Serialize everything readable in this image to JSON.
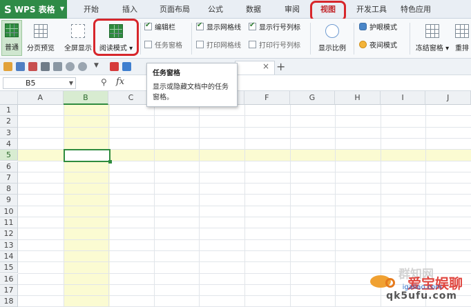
{
  "app": {
    "logo_mark": "S",
    "name": "WPS 表格"
  },
  "tabs": [
    "开始",
    "插入",
    "页面布局",
    "公式",
    "数据",
    "审阅",
    "视图",
    "开发工具",
    "特色应用"
  ],
  "active_tab": "视图",
  "ribbon": {
    "normal": "普通",
    "page_preview": "分页预览",
    "fullscreen": "全屏显示",
    "reading_mode": "阅读模式",
    "edit_bar": "编辑栏",
    "task_pane": "任务窗格",
    "show_gridlines": "显示网格线",
    "print_gridlines": "打印网格线",
    "show_row_col_headers": "显示行号列标",
    "print_row_col_headers": "打印行号列标",
    "zoom": "显示比例",
    "eye_protection": "护眼模式",
    "night_mode": "夜间模式",
    "freeze_panes": "冻结窗格",
    "rearrange": "重排"
  },
  "formula_bar": {
    "cell_ref": "B5",
    "fx": "fx"
  },
  "tooltip": {
    "title": "任务窗格",
    "body": "显示或隐藏文档中的任务窗格。"
  },
  "doc_tab": {
    "close": "×",
    "new": "+"
  },
  "columns": [
    "A",
    "B",
    "C",
    "D",
    "E",
    "F",
    "G",
    "H",
    "I",
    "J"
  ],
  "rows": [
    "1",
    "2",
    "3",
    "4",
    "5",
    "6",
    "7",
    "8",
    "9",
    "10",
    "11",
    "12",
    "13",
    "14",
    "15",
    "16",
    "17",
    "18"
  ],
  "selected_col": "B",
  "selected_row": "5",
  "watermark": {
    "top": "群知网",
    "mid": "爱宝娱聊",
    "site": "igaiiao.com",
    "sub": "qk5ufu.com"
  },
  "colors": {
    "accent": "#2e8b3e",
    "highlight": "#fbfbd2",
    "annotation": "#d7262b"
  }
}
